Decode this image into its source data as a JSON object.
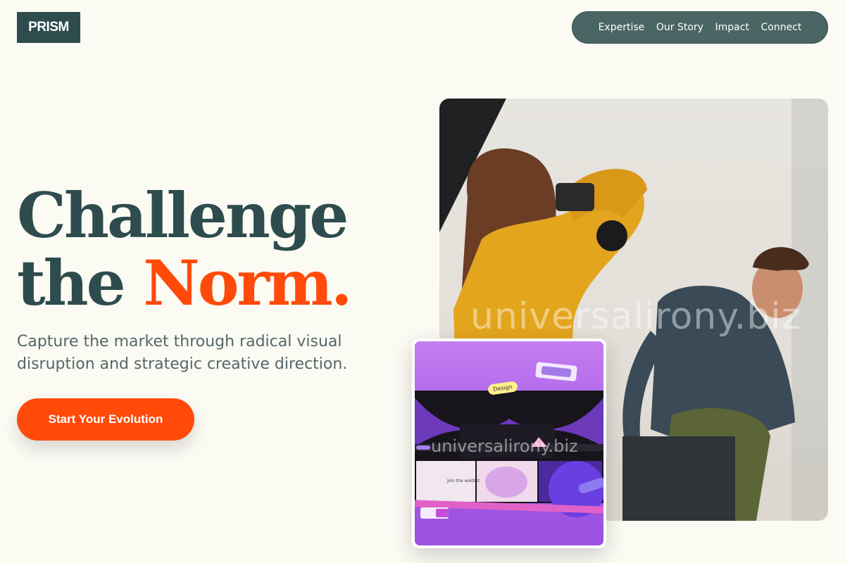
{
  "brand": {
    "logo": "PRISM"
  },
  "nav": {
    "items": [
      "Expertise",
      "Our Story",
      "Impact",
      "Connect"
    ]
  },
  "hero": {
    "headline_line1": "Challenge",
    "headline_line2_plain": "the ",
    "headline_line2_accent": "Norm.",
    "subtext": "Capture the market through radical visual disruption and strategic creative direction.",
    "cta": "Start Your Evolution"
  },
  "watermark": {
    "text": "universalirony.biz"
  },
  "card": {
    "tag": "Design",
    "join": "Join the waitlist"
  },
  "colors": {
    "primary": "#2e4c4e",
    "accent": "#ff4a0a",
    "background": "#fbfaf3",
    "nav_bg": "#4a6664"
  }
}
